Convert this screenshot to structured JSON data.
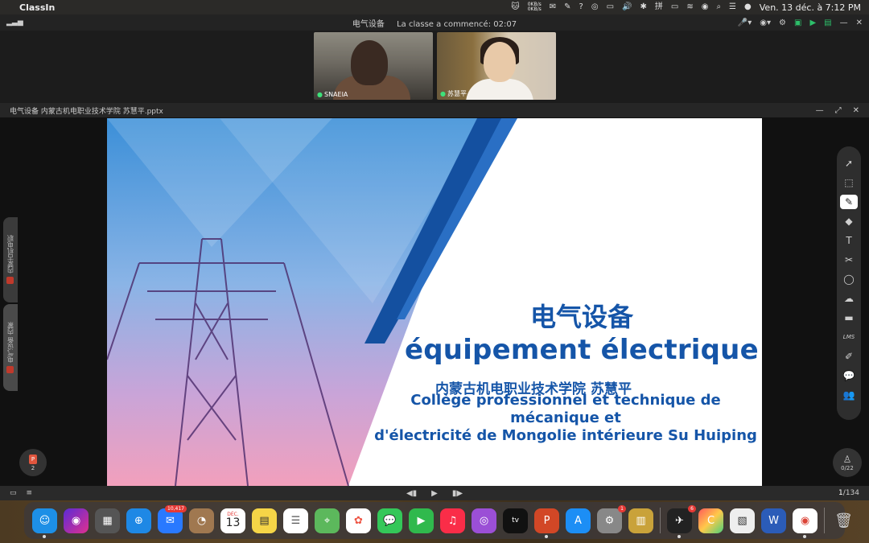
{
  "menubar": {
    "app_name": "ClassIn",
    "net_up": "0KB/s",
    "net_down": "0KB/s",
    "clock": "Ven. 13 déc. à  7:12 PM"
  },
  "topbar": {
    "course": "电气设备",
    "class_started_label": "La classe a commencé: 02:07"
  },
  "videos": [
    {
      "name": "SNAEIA"
    },
    {
      "name": "苏慧平"
    }
  ],
  "document": {
    "title": "电气设备  内蒙古机电职业技术学院 苏慧平.pptx"
  },
  "slide": {
    "title_cn": "电气设备",
    "title_fr": "équipement électrique",
    "author_cn": "内蒙古机电职业技术学院  苏慧平",
    "author_fr_line1": "Collège professionnel et technique de",
    "author_fr_line2": "mécanique et",
    "author_fr_line3": "d'électricité de Mongolie intérieure Su Huiping"
  },
  "side_tabs": {
    "tab_a": "内蒙古机电职",
    "tab_b": "电气设备  内蒙"
  },
  "files_count": "2",
  "seat_count": "0/22",
  "pager": {
    "current": "1",
    "total": "/134"
  },
  "dock": {
    "mail_badge": "10,417",
    "calendar_month": "DÉC.",
    "calendar_day": "13",
    "settings_badge": "1",
    "app_badge": "6",
    "tv_label": "tv"
  },
  "colors": {
    "slide_text": "#1555a8",
    "accent_green": "#2dbf6a"
  }
}
